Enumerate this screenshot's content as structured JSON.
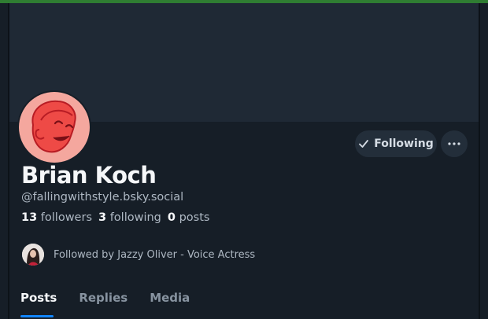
{
  "profile": {
    "name": "Brian Koch",
    "handle": "@fallingwithstyle.bsky.social",
    "followers_count": "13",
    "followers_label": "followers",
    "following_count": "3",
    "following_label": "following",
    "posts_count": "0",
    "posts_label": "posts",
    "followed_by": "Followed by Jazzy Oliver - Voice Actress"
  },
  "actions": {
    "following_label": "Following",
    "more_icon": "ellipsis-icon"
  },
  "tabs": [
    {
      "label": "Posts",
      "active": true
    },
    {
      "label": "Replies",
      "active": false
    },
    {
      "label": "Media",
      "active": false
    }
  ],
  "colors": {
    "accent": "#1185fe",
    "background": "#161e27",
    "banner": "#1f2935",
    "avatar": "#f4a79e"
  }
}
